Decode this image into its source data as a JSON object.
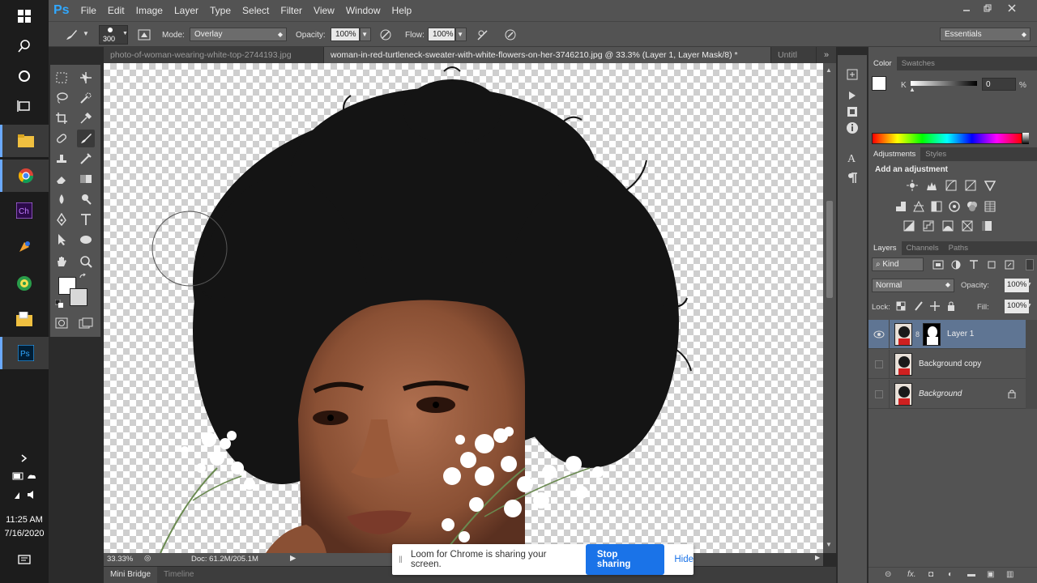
{
  "taskbar": {
    "time": "11:25 AM",
    "date": "7/16/2020",
    "apps": [
      "start-icon",
      "search-icon",
      "cortana-icon",
      "task-view-icon",
      "file-explorer-icon",
      "chrome-icon",
      "character-animator-icon",
      "app-icon",
      "app2-icon",
      "folder-icon",
      "photoshop-icon"
    ]
  },
  "menubar": {
    "logo": "Ps",
    "items": [
      "File",
      "Edit",
      "Image",
      "Layer",
      "Type",
      "Select",
      "Filter",
      "View",
      "Window",
      "Help"
    ]
  },
  "options": {
    "brush_size": "300",
    "mode_label": "Mode:",
    "mode_value": "Overlay",
    "opacity_label": "Opacity:",
    "opacity_value": "100%",
    "flow_label": "Flow:",
    "flow_value": "100%",
    "workspace": "Essentials"
  },
  "tabs": [
    {
      "label": "photo-of-woman-wearing-white-top-2744193.jpg"
    },
    {
      "label": "woman-in-red-turtleneck-sweater-with-white-flowers-on-her-3746210.jpg @ 33.3% (Layer 1, Layer Mask/8) *"
    },
    {
      "label": "Untitl"
    }
  ],
  "status": {
    "zoom": "33.33%",
    "doc": "Doc: 61.2M/205.1M"
  },
  "bottom_tabs": [
    "Mini Bridge",
    "Timeline"
  ],
  "color_panel": {
    "tabs": [
      "Color",
      "Swatches"
    ],
    "channel": "K",
    "value": "0",
    "unit": "%"
  },
  "adjustments_panel": {
    "tabs": [
      "Adjustments",
      "Styles"
    ],
    "heading": "Add an adjustment"
  },
  "layers_panel": {
    "tabs": [
      "Layers",
      "Channels",
      "Paths"
    ],
    "kind": "Kind",
    "blend_mode": "Normal",
    "opacity_label": "Opacity:",
    "opacity_value": "100%",
    "lock_label": "Lock:",
    "fill_label": "Fill:",
    "fill_value": "100%",
    "layers": [
      {
        "name": "Layer 1"
      },
      {
        "name": "Background copy"
      },
      {
        "name": "Background"
      }
    ]
  },
  "loom": {
    "message": "Loom for Chrome is sharing your screen.",
    "stop_label": "Stop sharing",
    "hide_label": "Hide"
  },
  "colors": {
    "ps_blue": "#31a8ff",
    "loom_blue": "#1a73e8",
    "selected_layer": "#5f7593"
  }
}
